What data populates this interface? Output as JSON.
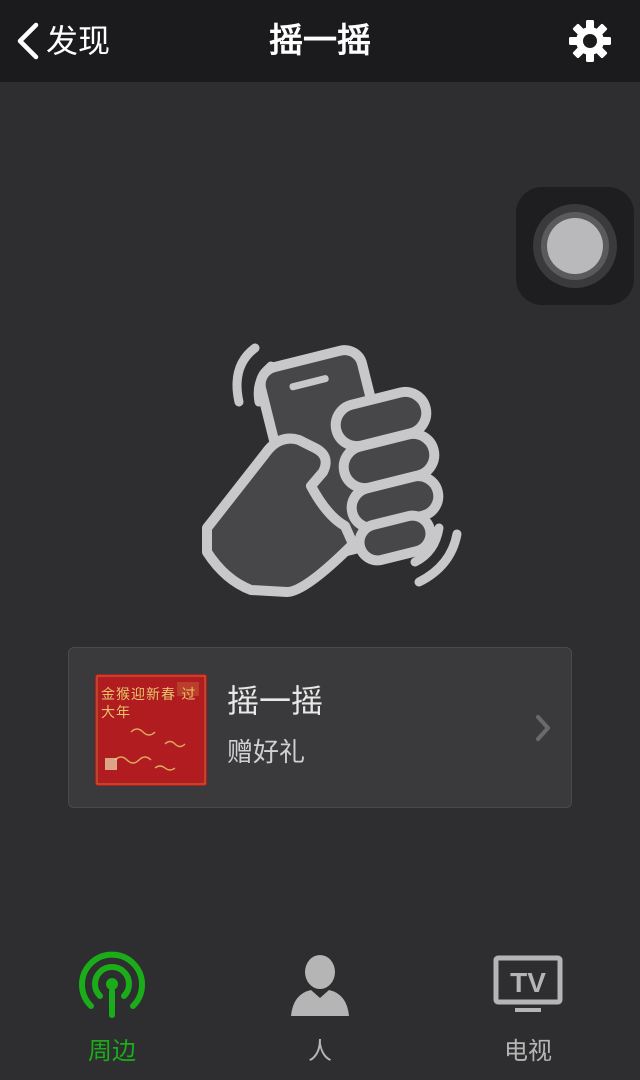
{
  "navbar": {
    "back_label": "发现",
    "title": "摇一摇",
    "back_icon": "chevron-left-icon",
    "settings_icon": "gear-icon"
  },
  "card": {
    "title": "摇一摇",
    "subtitle": "赠好礼",
    "thumbnail_text": "金猴迎新春 过大年",
    "chevron_icon": "chevron-right-icon"
  },
  "tabs": [
    {
      "label": "周边",
      "icon": "broadcast-icon",
      "active": true
    },
    {
      "label": "人",
      "icon": "person-icon",
      "active": false
    },
    {
      "label": "电视",
      "icon": "tv-icon",
      "active": false
    }
  ],
  "colors": {
    "background": "#2e2e30",
    "navbar": "#1b1b1d",
    "active_tab": "#1aad19",
    "inactive_tab": "#b5b5b5",
    "card": "#3a3a3c"
  }
}
